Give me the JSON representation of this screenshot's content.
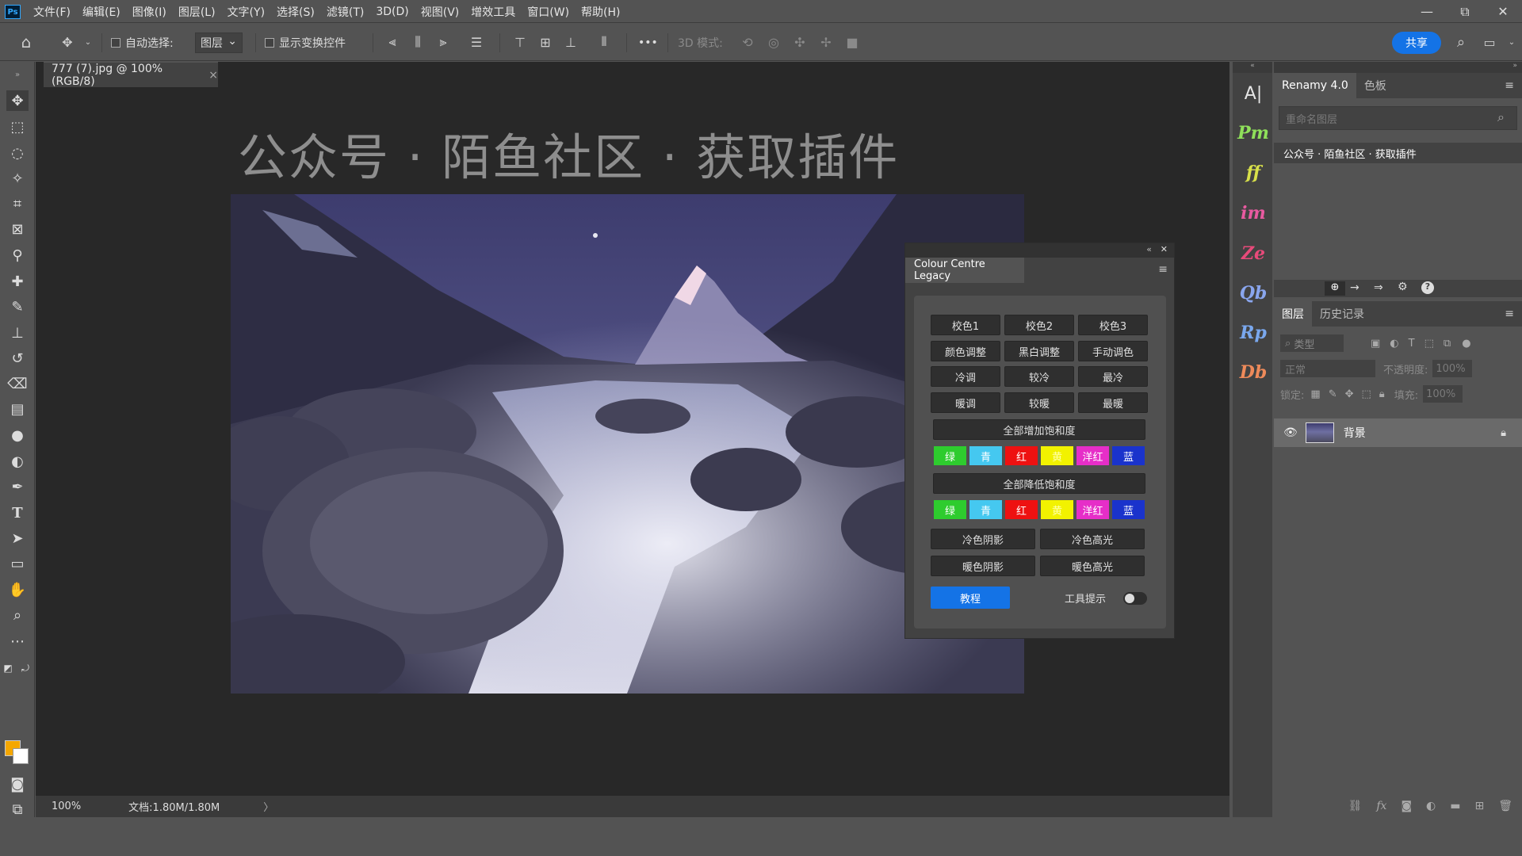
{
  "app": {
    "logo": "Ps"
  },
  "menu": [
    "文件(F)",
    "编辑(E)",
    "图像(I)",
    "图层(L)",
    "文字(Y)",
    "选择(S)",
    "滤镜(T)",
    "3D(D)",
    "视图(V)",
    "增效工具",
    "窗口(W)",
    "帮助(H)"
  ],
  "window_controls": {
    "minimize": "—",
    "restore": "⧉",
    "close": "✕"
  },
  "options": {
    "auto_select_label": "自动选择:",
    "auto_select_value": "图层",
    "show_transform_label": "显示变换控件",
    "mode_3d_label": "3D 模式:",
    "more": "•••",
    "share": "共享"
  },
  "document": {
    "tab_title": "777 (7).jpg @ 100%(RGB/8)",
    "tab_close": "×",
    "watermark": "公众号 · 陌鱼社区 · 获取插件",
    "zoom": "100%",
    "doc_info": "文档:1.80M/1.80M",
    "status_arrow": "〉"
  },
  "ccl": {
    "title": "Colour Centre Legacy",
    "collapse": "«",
    "close": "✕",
    "menu": "≡",
    "grid": [
      [
        "校色1",
        "校色2",
        "校色3"
      ],
      [
        "颜色调整",
        "黑白调整",
        "手动调色"
      ],
      [
        "冷调",
        "较冷",
        "最冷"
      ],
      [
        "暖调",
        "较暖",
        "最暖"
      ]
    ],
    "increase_sat": "全部增加饱和度",
    "decrease_sat": "全部降低饱和度",
    "swatches": [
      {
        "label": "绿",
        "color": "#2ecc2e"
      },
      {
        "label": "青",
        "color": "#45c8f0"
      },
      {
        "label": "红",
        "color": "#ee1111"
      },
      {
        "label": "黄",
        "color": "#f2f200"
      },
      {
        "label": "洋红",
        "color": "#e62ec8"
      },
      {
        "label": "蓝",
        "color": "#1a33cc"
      }
    ],
    "shadows_highlights": [
      [
        "冷色阴影",
        "冷色高光"
      ],
      [
        "暖色阴影",
        "暖色高光"
      ]
    ],
    "tutorial": "教程",
    "tooltip_label": "工具提示",
    "accent": "#1473e6"
  },
  "plugins": [
    "A|",
    "Pm",
    "ff",
    "im",
    "Ze",
    "Qb",
    "Rp",
    "Db"
  ],
  "renamy": {
    "tab1": "Renamy 4.0",
    "tab2": "色板",
    "search_placeholder": "重命名图层",
    "selected_layer_name": "公众号 · 陌鱼社区 · 获取插件"
  },
  "layers": {
    "tab1": "图层",
    "tab2": "历史记录",
    "filter_label": "类型",
    "blend_mode": "正常",
    "opacity_label": "不透明度:",
    "opacity_value": "100%",
    "lock_label": "锁定:",
    "fill_label": "填充:",
    "fill_value": "100%",
    "items": [
      {
        "name": "背景"
      }
    ]
  }
}
